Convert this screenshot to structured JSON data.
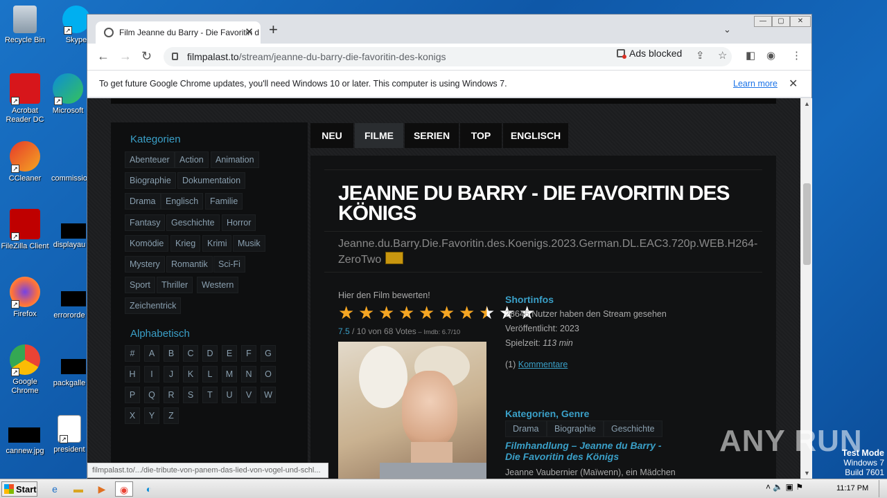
{
  "desktop": {
    "icons": [
      {
        "label": "Recycle Bin"
      },
      {
        "label": "Skype"
      },
      {
        "label": "Acrobat Reader DC"
      },
      {
        "label": "Microsoft"
      },
      {
        "label": "CCleaner"
      },
      {
        "label": "commissio"
      },
      {
        "label": "FileZilla Client"
      },
      {
        "label": "displayau"
      },
      {
        "label": "Firefox"
      },
      {
        "label": "errororde"
      },
      {
        "label": "Google Chrome"
      },
      {
        "label": "packgalle"
      },
      {
        "label": "cannew.jpg"
      },
      {
        "label": "president"
      }
    ]
  },
  "browser": {
    "tab_title": "Film Jeanne du Barry - Die Favoritin d",
    "url_host": "filmpalast.to",
    "url_path": "/stream/jeanne-du-barry-die-favoritin-des-konigs",
    "ads_blocked": "Ads blocked",
    "infobar_text": "To get future Google Chrome updates, you'll need Windows 10 or later. This computer is using Windows 7.",
    "learn_more": "Learn more",
    "status_url": "filmpalast.to/.../die-tribute-von-panem-das-lied-von-vogel-und-schl..."
  },
  "page": {
    "sidebar": {
      "categories_heading": "Kategorien",
      "categories": [
        "Abenteuer",
        "Action",
        "Animation",
        "Biographie",
        "Dokumentation",
        "Drama",
        "Englisch",
        "Familie",
        "Fantasy",
        "Geschichte",
        "Horror",
        "Komödie",
        "Krieg",
        "Krimi",
        "Musik",
        "Mystery",
        "Romantik",
        "Sci-Fi",
        "Sport",
        "Thriller",
        "Western",
        "Zeichentrick"
      ],
      "alpha_heading": "Alphabetisch",
      "alpha": [
        "#",
        "A",
        "B",
        "C",
        "D",
        "E",
        "F",
        "G",
        "H",
        "I",
        "J",
        "K",
        "L",
        "M",
        "N",
        "O",
        "P",
        "Q",
        "R",
        "S",
        "T",
        "U",
        "V",
        "W",
        "X",
        "Y",
        "Z"
      ]
    },
    "nav": [
      "NEU",
      "FILME",
      "SERIEN",
      "TOP",
      "ENGLISCH"
    ],
    "nav_active": "FILME",
    "movie": {
      "title": "JEANNE DU BARRY - DIE FAVORITIN DES KÖNIGS",
      "release": "Jeanne.du.Barry.Die.Favoritin.des.Koenigs.2023.German.DL.EAC3.720p.WEB.H264-ZeroTwo",
      "rate_label": "Hier den Film bewerten!",
      "rating": 7.5,
      "rating_max": 10,
      "score": "7.5",
      "votes_text": " / 10 von 68 Votes",
      "imdb_text": " – Imdb: 6.7/10",
      "shortinfos_heading": "Shortinfos",
      "views": "28646 Nutzer haben den Stream gesehen",
      "released": "Veröffentlicht: 2023",
      "runtime_label": "Spielzeit: ",
      "runtime": "113 min",
      "comments_count": "(1)",
      "comments_link": "Kommentare",
      "genre_heading": "Kategorien, Genre",
      "genres": [
        "Drama",
        "Biographie",
        "Geschichte"
      ],
      "plot_heading": "Filmhandlung – Jeanne du Barry - Die Favoritin des Königs",
      "plot_start": "Jeanne Vaubernier (Maïwenn), ein Mädchen"
    }
  },
  "overlay": {
    "watermark": "ANY RUN",
    "test_mode": "Test Mode",
    "os": "Windows 7",
    "build": "Build 7601"
  },
  "taskbar": {
    "start": "Start",
    "clock": "11:17 PM"
  }
}
